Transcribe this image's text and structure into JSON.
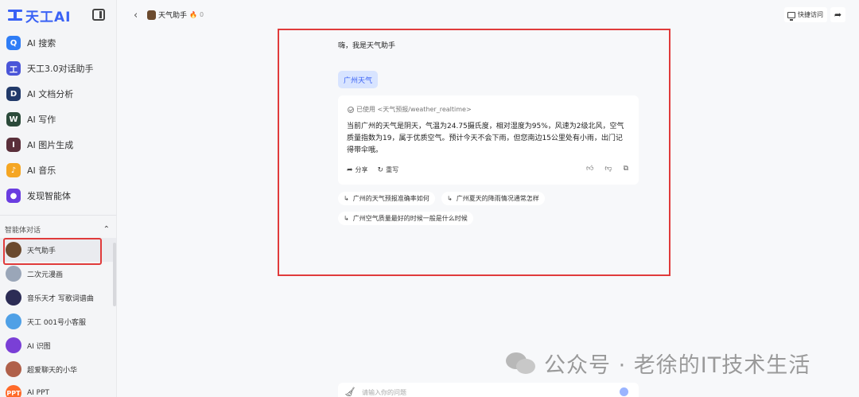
{
  "sidebar": {
    "logo_text": "天工AI",
    "nav": [
      {
        "label": "AI 搜索",
        "icon": "search-icon",
        "color": "#2f7df6",
        "glyph": "Q"
      },
      {
        "label": "天工3.0对话助手",
        "icon": "tiangong-logo-icon",
        "color": "#4a55d8",
        "glyph": "工"
      },
      {
        "label": "AI 文档分析",
        "icon": "document-analysis-icon",
        "color": "#223a6a",
        "glyph": "D"
      },
      {
        "label": "AI 写作",
        "icon": "writing-icon",
        "color": "#2b4a3a",
        "glyph": "W"
      },
      {
        "label": "AI 图片生成",
        "icon": "image-generation-icon",
        "color": "#5a2f3a",
        "glyph": "I"
      },
      {
        "label": "AI 音乐",
        "icon": "music-icon",
        "color": "#f5a623",
        "glyph": "♪"
      },
      {
        "label": "发现智能体",
        "icon": "discover-agents-icon",
        "color": "#6a3de0",
        "glyph": "●"
      }
    ],
    "section_title": "智能体对话",
    "agents": [
      {
        "label": "天气助手",
        "color": "#6b4a2e",
        "glyph": ""
      },
      {
        "label": "二次元漫画",
        "color": "#9aa6b8",
        "glyph": ""
      },
      {
        "label": "音乐天才 写歌词谱曲",
        "color": "#2c2c55",
        "glyph": ""
      },
      {
        "label": "天工 001号小客服",
        "color": "#4fa0e6",
        "glyph": ""
      },
      {
        "label": "AI 识图",
        "color": "#7a3fd6",
        "glyph": ""
      },
      {
        "label": "超爱聊天的小华",
        "color": "#b0604a",
        "glyph": ""
      },
      {
        "label": "AI PPT",
        "color": "#ff6a2a",
        "glyph": "PPT"
      }
    ]
  },
  "header": {
    "title": "天气助手",
    "fire_count": "0",
    "quick_access": "快捷访问"
  },
  "chat": {
    "greeting": "嗨，我是天气助手",
    "user_message": "广州天气",
    "used_tool": "已使用 <天气预报/weather_realtime>",
    "answer": "当前广州的天气是阴天，气温为24.75摄氏度，相对湿度为95%，风速为2级北风，空气质量指数为19，属于优质空气。预计今天不会下雨，但您南边15公里处有小雨，出门记得带伞哦。",
    "share_label": "分享",
    "rewrite_label": "重写",
    "suggestions": [
      "广州的天气预报准确率如何",
      "广州夏天的降雨情况通常怎样",
      "广州空气质量最好的时候一般是什么时候"
    ]
  },
  "input": {
    "placeholder": "请输入你的问题"
  },
  "watermark": "公众号 · 老徐的IT技术生活"
}
